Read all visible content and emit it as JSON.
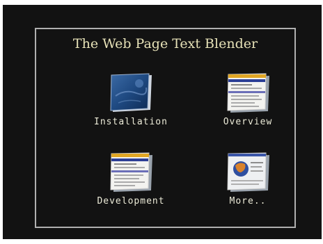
{
  "title": "The Web Page Text Blender",
  "title_color": "#e7e2b8",
  "menu": [
    {
      "label": "Installation",
      "icon": "installation-thumbnail-icon"
    },
    {
      "label": "Overview",
      "icon": "overview-page-thumbnail-icon"
    },
    {
      "label": "Development",
      "icon": "development-page-thumbnail-icon"
    },
    {
      "label": "More..",
      "icon": "more-globe-thumbnail-icon"
    }
  ]
}
